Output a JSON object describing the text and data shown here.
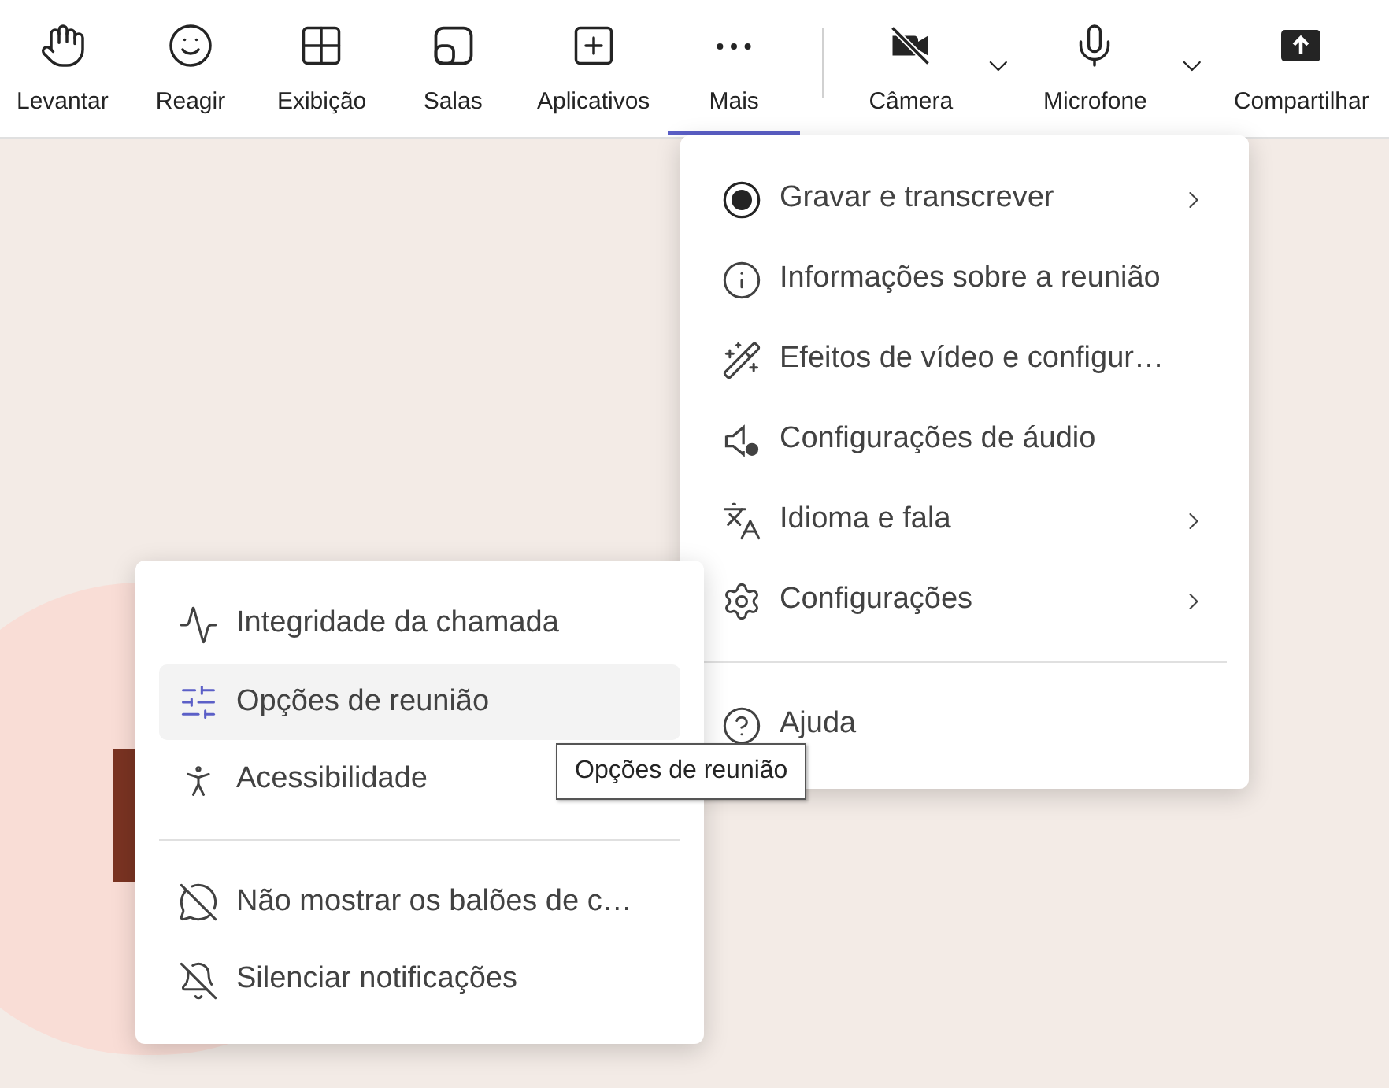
{
  "toolbar": {
    "buttons": [
      {
        "label": "Levantar",
        "selected": false,
        "has_dropdown": false
      },
      {
        "label": "Reagir",
        "selected": false,
        "has_dropdown": false
      },
      {
        "label": "Exibição",
        "selected": false,
        "has_dropdown": false
      },
      {
        "label": "Salas",
        "selected": false,
        "has_dropdown": false
      },
      {
        "label": "Aplicativos",
        "selected": false,
        "has_dropdown": false
      },
      {
        "label": "Mais",
        "selected": true,
        "has_dropdown": false
      },
      {
        "label": "Câmera",
        "selected": false,
        "has_dropdown": true
      },
      {
        "label": "Microfone",
        "selected": false,
        "has_dropdown": true
      },
      {
        "label": "Compartilhar",
        "selected": false,
        "has_dropdown": false
      }
    ]
  },
  "more_menu": {
    "groups": [
      [
        {
          "label": "Gravar e transcrever",
          "submenu": true
        },
        {
          "label": "Informações sobre a reunião",
          "submenu": false
        },
        {
          "label": "Efeitos de vídeo e configur…",
          "submenu": false
        },
        {
          "label": "Configurações de áudio",
          "submenu": false
        },
        {
          "label": "Idioma e fala",
          "submenu": true
        },
        {
          "label": "Configurações",
          "submenu": true
        }
      ],
      [
        {
          "label": "Ajuda",
          "submenu": false
        }
      ]
    ]
  },
  "settings_submenu": {
    "groups": [
      [
        {
          "label": "Integridade da chamada",
          "selected": false
        },
        {
          "label": "Opções de reunião",
          "selected": true
        },
        {
          "label": "Acessibilidade",
          "selected": false
        }
      ],
      [
        {
          "label": "Não mostrar os balões de c…",
          "selected": false
        },
        {
          "label": "Silenciar notificações",
          "selected": false
        }
      ]
    ]
  },
  "tooltip": {
    "text": "Opções de reunião"
  }
}
